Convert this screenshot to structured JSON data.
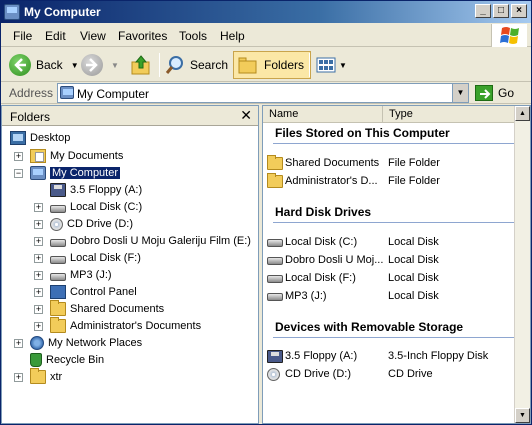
{
  "window": {
    "title": "My Computer"
  },
  "menubar": {
    "items": [
      "File",
      "Edit",
      "View",
      "Favorites",
      "Tools",
      "Help"
    ]
  },
  "toolbar": {
    "back": "Back",
    "search": "Search",
    "folders": "Folders"
  },
  "address": {
    "label": "Address",
    "value": "My Computer",
    "go": "Go"
  },
  "folders": {
    "title": "Folders",
    "tree": [
      {
        "label": "Desktop",
        "icon": "desktop-icon"
      },
      {
        "label": "My Documents",
        "icon": "my-documents-icon",
        "expander": "+"
      },
      {
        "label": "My Computer",
        "icon": "my-computer-icon",
        "expander": "−",
        "selected": true
      },
      {
        "label": "3.5 Floppy (A:)",
        "icon": "floppy-icon"
      },
      {
        "label": "Local Disk (C:)",
        "icon": "hard-disk-icon",
        "expander": "+"
      },
      {
        "label": "CD Drive (D:)",
        "icon": "cd-drive-icon",
        "expander": "+"
      },
      {
        "label": "Dobro Dosli U Moju Galeriju Film (E:)",
        "icon": "hard-disk-icon",
        "expander": "+"
      },
      {
        "label": "Local Disk (F:)",
        "icon": "hard-disk-icon",
        "expander": "+"
      },
      {
        "label": "MP3 (J:)",
        "icon": "hard-disk-icon",
        "expander": "+"
      },
      {
        "label": "Control Panel",
        "icon": "control-panel-icon",
        "expander": "+"
      },
      {
        "label": "Shared Documents",
        "icon": "folder-icon",
        "expander": "+"
      },
      {
        "label": "Administrator's Documents",
        "icon": "folder-icon",
        "expander": "+"
      },
      {
        "label": "My Network Places",
        "icon": "network-places-icon",
        "expander": "+"
      },
      {
        "label": "Recycle Bin",
        "icon": "recycle-bin-icon"
      },
      {
        "label": "xtr",
        "icon": "folder-icon",
        "expander": "+"
      }
    ]
  },
  "columns": {
    "name": "Name",
    "type": "Type"
  },
  "groups": [
    {
      "title": "Files Stored on This Computer",
      "items": [
        {
          "name": "Shared Documents",
          "type": "File Folder",
          "icon": "folder-icon"
        },
        {
          "name": "Administrator's D...",
          "type": "File Folder",
          "icon": "folder-icon"
        }
      ]
    },
    {
      "title": "Hard Disk Drives",
      "items": [
        {
          "name": "Local Disk (C:)",
          "type": "Local Disk",
          "icon": "hard-disk-icon"
        },
        {
          "name": "Dobro Dosli U Moj...",
          "type": "Local Disk",
          "icon": "hard-disk-icon"
        },
        {
          "name": "Local Disk (F:)",
          "type": "Local Disk",
          "icon": "hard-disk-icon"
        },
        {
          "name": "MP3 (J:)",
          "type": "Local Disk",
          "icon": "hard-disk-icon"
        }
      ]
    },
    {
      "title": "Devices with Removable Storage",
      "items": [
        {
          "name": "3.5 Floppy (A:)",
          "type": "3.5-Inch Floppy Disk",
          "icon": "floppy-icon"
        },
        {
          "name": "CD Drive (D:)",
          "type": "CD Drive",
          "icon": "cd-drive-icon"
        }
      ]
    }
  ],
  "colors": {
    "selection": "#0a246a",
    "title_bar": "#0a246a",
    "group_line": "#8ea6d0"
  }
}
